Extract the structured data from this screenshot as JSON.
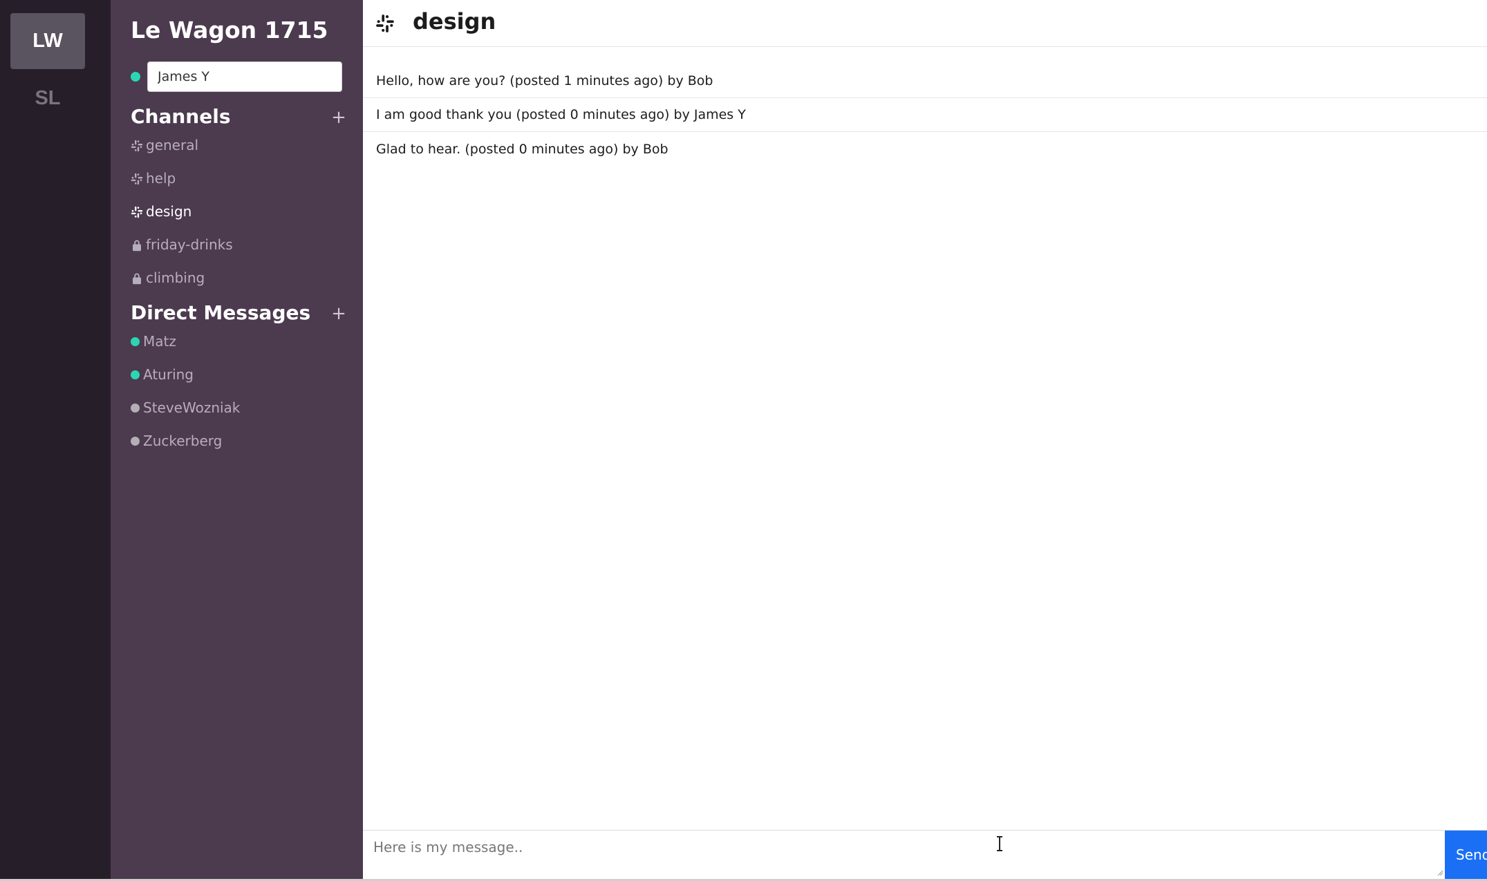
{
  "workspaces": [
    {
      "label": "LW",
      "active": true
    },
    {
      "label": "SL",
      "active": false
    }
  ],
  "sidebar": {
    "org_name": "Le Wagon 1715",
    "current_user": "James Y",
    "channels_title": "Channels",
    "add_channel_label": "+",
    "channels": [
      {
        "name": "general",
        "private": false,
        "active": false
      },
      {
        "name": "help",
        "private": false,
        "active": false
      },
      {
        "name": "design",
        "private": false,
        "active": true
      },
      {
        "name": "friday-drinks",
        "private": true,
        "active": false
      },
      {
        "name": "climbing",
        "private": true,
        "active": false
      }
    ],
    "dm_title": "Direct Messages",
    "add_dm_label": "+",
    "direct_messages": [
      {
        "name": "Matz",
        "online": true
      },
      {
        "name": "Aturing",
        "online": true
      },
      {
        "name": "SteveWozniak",
        "online": false
      },
      {
        "name": "Zuckerberg",
        "online": false
      }
    ]
  },
  "channel": {
    "title": "design",
    "icon": "slack-hash-icon"
  },
  "messages": [
    "Hello, how are you? (posted 1 minutes ago) by Bob",
    "I am good thank you (posted 0 minutes ago) by James Y",
    "Glad to hear. (posted 0 minutes ago) by Bob"
  ],
  "composer": {
    "placeholder": "Here is my message..",
    "send_label": "Send"
  },
  "colors": {
    "rail": "#261e29",
    "sidebar": "#4c3a4f",
    "online": "#2bd7b3",
    "send": "#1a6ff5"
  }
}
